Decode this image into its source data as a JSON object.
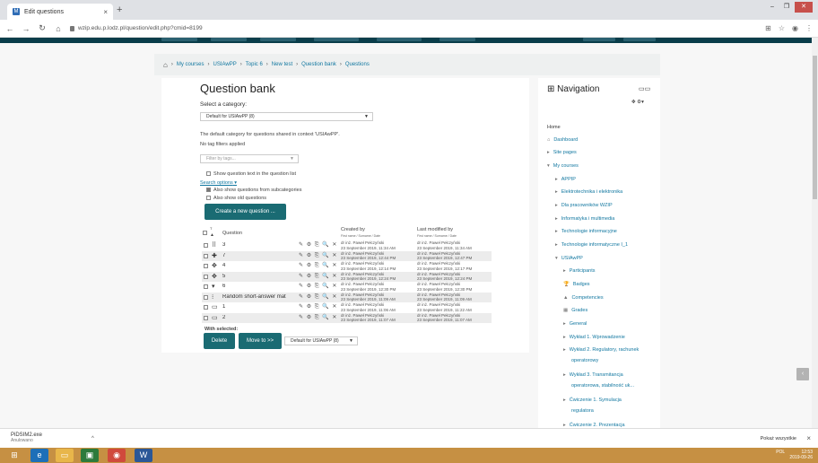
{
  "browser": {
    "tab_title": "Edit questions",
    "url": "wzip.edu.p.lodz.pl/question/edit.php?cmid=8199",
    "new_tab": "+",
    "tab_close": "×"
  },
  "breadcrumb": [
    "My courses",
    "USIAwPP",
    "Topic 6",
    "New test",
    "Question bank",
    "Questions"
  ],
  "main": {
    "title": "Question bank",
    "select_category_label": "Select a category:",
    "category_value": "Default for USIAwPP (8)",
    "category_info": "The default category for questions shared in context 'USIAwPP'.",
    "no_tag_filters": "No tag filters applied",
    "filter_placeholder": "Filter by tags...",
    "show_question_text": "Show question text in the question list",
    "search_options": "Search options",
    "also_subcategories": "Also show questions from subcategories",
    "also_old": "Also show old questions",
    "create_button": "Create a new question ...",
    "col_question": "Question",
    "col_created": "Created by",
    "col_created_sub": "First name / Surname / Date",
    "col_modified": "Last modified by",
    "col_modified_sub": "First name / Surname / Date",
    "sort_indicator": "T",
    "with_selected": "With selected:",
    "delete_button": "Delete",
    "move_button": "Move to >>",
    "move_target": "Default for USIAwPP (8)"
  },
  "questions": [
    {
      "icon": "drag-drop-icon",
      "glyph": "⠿",
      "name": "3",
      "created_name": "dr inż. Paweł Pełczyński",
      "created_date": "23 September 2019, 11:34 AM",
      "modified_name": "dr inż. Paweł Pełczyński",
      "modified_date": "23 September 2019, 11:34 AM"
    },
    {
      "icon": "cross-icon",
      "glyph": "✚",
      "name": "7",
      "created_name": "dr inż. Paweł Pełczyński",
      "created_date": "23 September 2019, 12:44 PM",
      "modified_name": "dr inż. Paweł Pełczyński",
      "modified_date": "23 September 2019, 12:47 PM"
    },
    {
      "icon": "move-arrows-icon",
      "glyph": "✥",
      "name": "4",
      "created_name": "dr inż. Paweł Pełczyński",
      "created_date": "23 September 2019, 12:14 PM",
      "modified_name": "dr inż. Paweł Pełczyński",
      "modified_date": "23 September 2019, 12:17 PM"
    },
    {
      "icon": "move-arrows-icon",
      "glyph": "✥",
      "name": "5",
      "created_name": "dr inż. Paweł Pełczyński",
      "created_date": "23 September 2019, 12:24 PM",
      "modified_name": "dr inż. Paweł Pełczyński",
      "modified_date": "23 September 2019, 12:24 PM"
    },
    {
      "icon": "dropdown-icon",
      "glyph": "▾",
      "name": "6",
      "created_name": "dr inż. Paweł Pełczyński",
      "created_date": "23 September 2019, 12:30 PM",
      "modified_name": "dr inż. Paweł Pełczyński",
      "modified_date": "23 September 2019, 12:30 PM"
    },
    {
      "icon": "random-icon",
      "glyph": "⁝",
      "name": "Random short-answer mat",
      "created_name": "dr inż. Paweł Pełczyński",
      "created_date": "23 September 2019, 11:09 AM",
      "modified_name": "dr inż. Paweł Pełczyński",
      "modified_date": "23 September 2019, 11:09 AM"
    },
    {
      "icon": "short-answer-icon",
      "glyph": "▭",
      "name": "1",
      "created_name": "dr inż. Paweł Pełczyński",
      "created_date": "23 September 2019, 11:06 AM",
      "modified_name": "dr inż. Paweł Pełczyński",
      "modified_date": "23 September 2019, 11:22 AM"
    },
    {
      "icon": "short-answer-icon",
      "glyph": "▭",
      "name": "2",
      "created_name": "dr inż. Paweł Pełczyński",
      "created_date": "23 September 2019, 11:07 AM",
      "modified_name": "dr inż. Paweł Pełczyński",
      "modified_date": "23 September 2019, 11:07 AM"
    }
  ],
  "row_actions": "✎ ⚙ ⎘ 🔍 ✕",
  "sidebar": {
    "title": "Navigation",
    "items": [
      {
        "label": "Home",
        "level": 0,
        "caret": ""
      },
      {
        "label": "Dashboard",
        "level": 0,
        "caret": "⌂"
      },
      {
        "label": "Site pages",
        "level": 0,
        "caret": "▸"
      },
      {
        "label": "My courses",
        "level": 0,
        "caret": "▾"
      },
      {
        "label": "APPIP",
        "level": 1,
        "caret": "▸"
      },
      {
        "label": "Elektrotechnika i elektronika",
        "level": 1,
        "caret": "▸"
      },
      {
        "label": "Dla pracowników WZIP",
        "level": 1,
        "caret": "▸"
      },
      {
        "label": "Informatyka i multimedia",
        "level": 1,
        "caret": "▸"
      },
      {
        "label": "Technologie informacyjne",
        "level": 1,
        "caret": "▸"
      },
      {
        "label": "Technologie informatyczne I_1",
        "level": 1,
        "caret": "▸"
      },
      {
        "label": "USIAwPP",
        "level": 1,
        "caret": "▾"
      },
      {
        "label": "Participants",
        "level": 2,
        "caret": "▸"
      },
      {
        "label": "Badges",
        "level": 2,
        "caret": "🏆"
      },
      {
        "label": "Competencies",
        "level": 2,
        "caret": "▲"
      },
      {
        "label": "Grades",
        "level": 2,
        "caret": "▦"
      },
      {
        "label": "General",
        "level": 2,
        "caret": "▸"
      },
      {
        "label": "Wykład 1. Wprowadzenie",
        "level": 2,
        "caret": "▸"
      },
      {
        "label": "Wykład 2. Regulatory, rachunek",
        "level": 2,
        "caret": "▸"
      },
      {
        "label": "operatorowy",
        "level": 2,
        "caret": ""
      },
      {
        "label": "Wykład 3. Transmitancja",
        "level": 2,
        "caret": "▸"
      },
      {
        "label": "operatorowa, stabilność uk...",
        "level": 2,
        "caret": ""
      },
      {
        "label": "Ćwiczenie 1. Symulacja",
        "level": 2,
        "caret": "▸"
      },
      {
        "label": "regulatora",
        "level": 2,
        "caret": ""
      },
      {
        "label": "Ćwiczenie 2. Prezentacja",
        "level": 2,
        "caret": "▸"
      }
    ]
  },
  "downloads": {
    "file": "PiDSIM2.exe",
    "status": "Anulowano",
    "show_all": "Pokaż wszystkie"
  },
  "taskbar": {
    "lang": "POL",
    "time": "12:53",
    "date": "2019-09-26"
  },
  "colors": {
    "navbar": "#0a3d4a",
    "button": "#1a6b73",
    "link": "#1177a0",
    "taskbar": "#c69043"
  }
}
